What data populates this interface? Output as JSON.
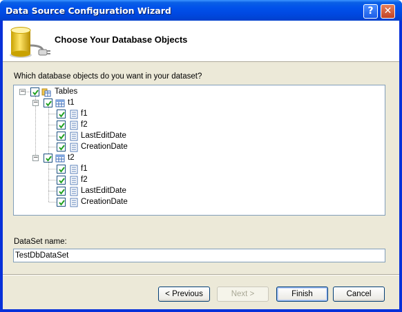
{
  "window": {
    "title": "Data Source Configuration Wizard",
    "help_glyph": "?",
    "close_glyph": "✕"
  },
  "header": {
    "title": "Choose Your Database Objects",
    "icon": "database-plug-icon"
  },
  "question": "Which database objects do you want in your dataset?",
  "tree": {
    "root": {
      "label": "Tables",
      "checked": true,
      "expanded": true
    },
    "tables": [
      {
        "label": "t1",
        "checked": true,
        "expanded": true,
        "columns": [
          {
            "label": "f1",
            "checked": true
          },
          {
            "label": "f2",
            "checked": true
          },
          {
            "label": "LastEditDate",
            "checked": true
          },
          {
            "label": "CreationDate",
            "checked": true
          }
        ]
      },
      {
        "label": "t2",
        "checked": true,
        "expanded": true,
        "columns": [
          {
            "label": "f1",
            "checked": true
          },
          {
            "label": "f2",
            "checked": true
          },
          {
            "label": "LastEditDate",
            "checked": true
          },
          {
            "label": "CreationDate",
            "checked": true
          }
        ]
      }
    ]
  },
  "dataset": {
    "label": "DataSet name:",
    "value": "TestDbDataSet"
  },
  "buttons": {
    "previous": "< Previous",
    "next": "Next >",
    "finish": "Finish",
    "cancel": "Cancel"
  },
  "colors": {
    "title_bar": "#0050ea",
    "dialog_bg": "#ece9d8",
    "tree_border": "#7f9db9",
    "check_mark": "#21a121"
  }
}
